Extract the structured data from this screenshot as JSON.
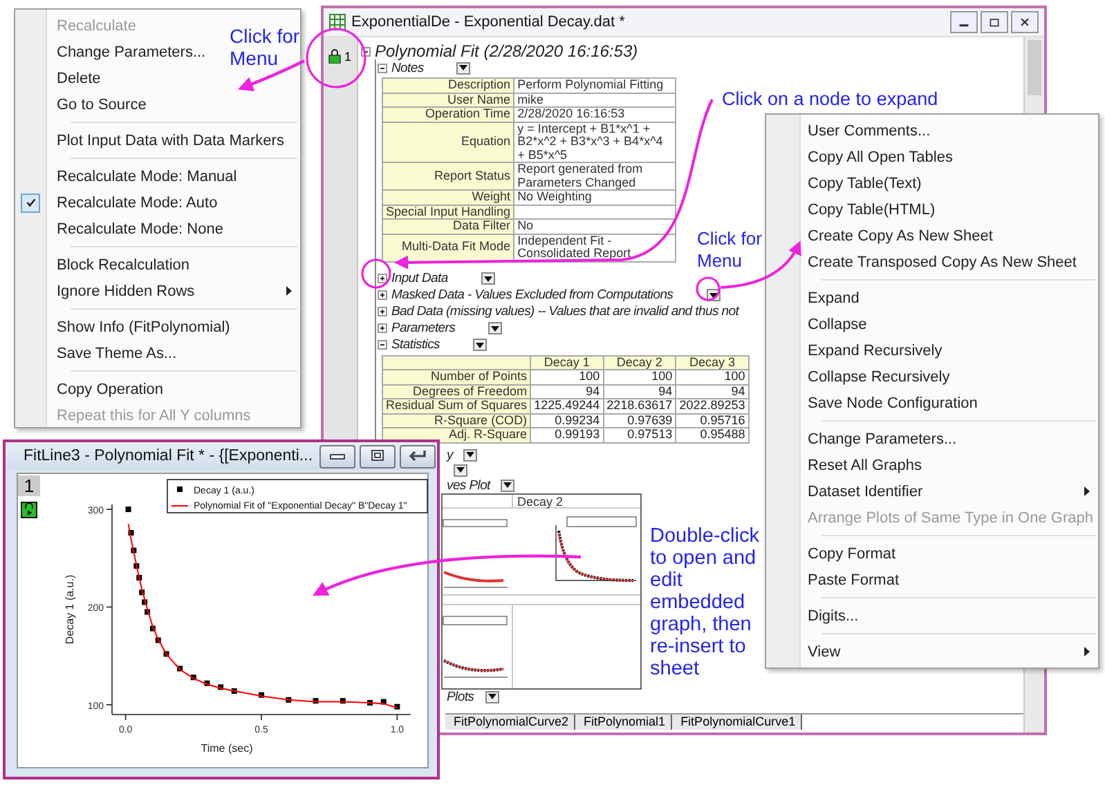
{
  "left_menu": {
    "items": [
      {
        "kind": "item",
        "label": "Recalculate",
        "disabled": true,
        "checked": false,
        "submenu": false
      },
      {
        "kind": "item",
        "label": "Change Parameters...",
        "disabled": false,
        "checked": false,
        "submenu": false
      },
      {
        "kind": "item",
        "label": "Delete",
        "disabled": false,
        "checked": false,
        "submenu": false
      },
      {
        "kind": "item",
        "label": "Go to Source",
        "disabled": false,
        "checked": false,
        "submenu": false
      },
      {
        "kind": "separator"
      },
      {
        "kind": "item",
        "label": "Plot Input Data with Data Markers",
        "disabled": false,
        "checked": false,
        "submenu": false
      },
      {
        "kind": "separator"
      },
      {
        "kind": "item",
        "label": "Recalculate Mode: Manual",
        "disabled": false,
        "checked": false,
        "submenu": false
      },
      {
        "kind": "item",
        "label": "Recalculate Mode: Auto",
        "disabled": false,
        "checked": true,
        "submenu": false
      },
      {
        "kind": "item",
        "label": "Recalculate Mode: None",
        "disabled": false,
        "checked": false,
        "submenu": false
      },
      {
        "kind": "separator"
      },
      {
        "kind": "item",
        "label": "Block Recalculation",
        "disabled": false,
        "checked": false,
        "submenu": false
      },
      {
        "kind": "item",
        "label": "Ignore Hidden Rows",
        "disabled": false,
        "checked": false,
        "submenu": true
      },
      {
        "kind": "separator"
      },
      {
        "kind": "item",
        "label": "Show Info (FitPolynomial)",
        "disabled": false,
        "checked": false,
        "submenu": false
      },
      {
        "kind": "item",
        "label": "Save Theme As...",
        "disabled": false,
        "checked": false,
        "submenu": false
      },
      {
        "kind": "separator"
      },
      {
        "kind": "item",
        "label": "Copy Operation",
        "disabled": false,
        "checked": false,
        "submenu": false
      },
      {
        "kind": "item",
        "label": "Repeat this for All Y columns",
        "disabled": true,
        "checked": false,
        "submenu": false
      }
    ]
  },
  "report_window": {
    "title": "ExponentialDe - Exponential Decay.dat *",
    "row_label": "1",
    "root": {
      "label": "Polynomial Fit (2/28/2020 16:16:53)",
      "expanded": true
    },
    "nodes": [
      {
        "kind": "table",
        "label": "Notes",
        "expanded": true,
        "dropdown": true,
        "rows": [
          {
            "label": "Description",
            "value": "Perform Polynomial Fitting"
          },
          {
            "label": "User Name",
            "value": "mike"
          },
          {
            "label": "Operation Time",
            "value": "2/28/2020 16:16:53"
          },
          {
            "label": "Equation",
            "value": "y = Intercept + B1*x^1 + B2*x^2 + B3*x^3 + B4*x^4 + B5*x^5"
          },
          {
            "label": "Report Status",
            "value": "Report generated from Parameters Changed"
          },
          {
            "label": "Weight",
            "value": "No Weighting"
          },
          {
            "label": "Special Input Handling",
            "value": ""
          },
          {
            "label": "Data Filter",
            "value": "No"
          },
          {
            "label": "Multi-Data Fit Mode",
            "value": "Independent Fit - Consolidated Report"
          }
        ]
      },
      {
        "kind": "node",
        "label": "Input Data",
        "expanded": false,
        "dropdown": true
      },
      {
        "kind": "node",
        "label": "Masked Data - Values Excluded from Computations",
        "expanded": false,
        "dropdown": true
      },
      {
        "kind": "node",
        "label": "Bad Data (missing values) -- Values that are invalid and thus not",
        "expanded": false,
        "dropdown": false
      },
      {
        "kind": "node",
        "label": "Parameters",
        "expanded": false,
        "dropdown": true
      },
      {
        "kind": "stats",
        "label": "Statistics",
        "expanded": true,
        "dropdown": true,
        "columns": [
          "Decay 1",
          "Decay 2",
          "Decay 3"
        ],
        "rows": [
          {
            "label": "Number of Points",
            "values": [
              "100",
              "100",
              "100"
            ]
          },
          {
            "label": "Degrees of Freedom",
            "values": [
              "94",
              "94",
              "94"
            ]
          },
          {
            "label": "Residual Sum of Squares",
            "values": [
              "1225.49244",
              "2218.63617",
              "2022.89253"
            ]
          },
          {
            "label": "R-Square (COD)",
            "values": [
              "0.99234",
              "0.97639",
              "0.95716"
            ]
          },
          {
            "label": "Adj. R-Square",
            "values": [
              "0.99193",
              "0.97513",
              "0.95488"
            ]
          }
        ]
      },
      {
        "kind": "clipped",
        "label": "y",
        "dropdown": true
      },
      {
        "kind": "clipped",
        "dropdown": true
      },
      {
        "kind": "clipped",
        "label": "ves Plot",
        "dropdown": true
      },
      {
        "kind": "graphs",
        "header": "Decay 2"
      },
      {
        "kind": "clipped",
        "label": "Plots",
        "dropdown": true
      }
    ],
    "sheet_tabs": [
      {
        "label": "FitPolynomialCurve2",
        "selected": false
      },
      {
        "label": "FitPolynomial1",
        "selected": false
      },
      {
        "label": "FitPolynomialCurve1",
        "selected": false
      }
    ]
  },
  "right_menu": {
    "items": [
      {
        "kind": "item",
        "label": "User Comments...",
        "disabled": false,
        "submenu": false
      },
      {
        "kind": "item",
        "label": "Copy All Open Tables",
        "disabled": false,
        "submenu": false
      },
      {
        "kind": "item",
        "label": "Copy Table(Text)",
        "disabled": false,
        "submenu": false
      },
      {
        "kind": "item",
        "label": "Copy Table(HTML)",
        "disabled": false,
        "submenu": false
      },
      {
        "kind": "item",
        "label": "Create Copy As New Sheet",
        "disabled": false,
        "submenu": false
      },
      {
        "kind": "item",
        "label": "Create Transposed Copy As New Sheet",
        "disabled": false,
        "submenu": false
      },
      {
        "kind": "separator"
      },
      {
        "kind": "item",
        "label": "Expand",
        "disabled": false,
        "submenu": false
      },
      {
        "kind": "item",
        "label": "Collapse",
        "disabled": false,
        "submenu": false
      },
      {
        "kind": "item",
        "label": "Expand Recursively",
        "disabled": false,
        "submenu": false
      },
      {
        "kind": "item",
        "label": "Collapse Recursively",
        "disabled": false,
        "submenu": false
      },
      {
        "kind": "item",
        "label": "Save Node Configuration",
        "disabled": false,
        "submenu": false
      },
      {
        "kind": "separator"
      },
      {
        "kind": "item",
        "label": "Change Parameters...",
        "disabled": false,
        "submenu": false
      },
      {
        "kind": "item",
        "label": "Reset All Graphs",
        "disabled": false,
        "submenu": false
      },
      {
        "kind": "item",
        "label": "Dataset Identifier",
        "disabled": false,
        "submenu": true
      },
      {
        "kind": "item",
        "label": "Arrange Plots of Same Type in One Graph",
        "disabled": true,
        "submenu": false
      },
      {
        "kind": "separator"
      },
      {
        "kind": "item",
        "label": "Copy Format",
        "disabled": false,
        "submenu": false
      },
      {
        "kind": "item",
        "label": "Paste Format",
        "disabled": false,
        "submenu": false
      },
      {
        "kind": "separator"
      },
      {
        "kind": "item",
        "label": "Digits...",
        "disabled": false,
        "submenu": false
      },
      {
        "kind": "separator"
      },
      {
        "kind": "item",
        "label": "View",
        "disabled": false,
        "submenu": true
      }
    ]
  },
  "graph_window": {
    "title": "FitLine3 - Polynomial Fit * - {[Exponenti...",
    "page_label": "1",
    "chart_data": {
      "type": "scatter",
      "xlabel": "Time (sec)",
      "ylabel": "Decay 1 (a.u.)",
      "x": [
        0.01,
        0.02,
        0.03,
        0.04,
        0.05,
        0.06,
        0.07,
        0.08,
        0.1,
        0.12,
        0.15,
        0.2,
        0.25,
        0.3,
        0.35,
        0.4,
        0.5,
        0.6,
        0.7,
        0.8,
        0.9,
        0.95,
        1.0
      ],
      "series": [
        {
          "name": "Decay 1 (a.u.)",
          "type": "scatter",
          "color": "#000000",
          "values": [
            300,
            276,
            258,
            242,
            230,
            215,
            205,
            195,
            178,
            166,
            152,
            137,
            128,
            122,
            118,
            114,
            110,
            105,
            104,
            104,
            102,
            103,
            98
          ]
        },
        {
          "name": "Polynomial Fit of \"Exponential Decay\" B\"Decay 1\"",
          "type": "line",
          "color": "#ff0000",
          "values": [
            285,
            270,
            256,
            243,
            230,
            218,
            208,
            198,
            180,
            167,
            152,
            136,
            127,
            121,
            117,
            114,
            109,
            105,
            103,
            103,
            102,
            101,
            97
          ]
        }
      ],
      "legend": true,
      "xlim": [
        -0.05,
        1.05
      ],
      "ylim": [
        90,
        305
      ],
      "xticks": [
        {
          "value": 0,
          "label": "0.0"
        },
        {
          "value": 0.5,
          "label": "0.5"
        },
        {
          "value": 1,
          "label": "1.0"
        }
      ],
      "yticks": [
        {
          "value": 100,
          "label": "100"
        },
        {
          "value": 200,
          "label": "200"
        },
        {
          "value": 300,
          "label": "300"
        }
      ]
    }
  },
  "annotations": [
    {
      "kind": "left_menu",
      "text": "Click for Menu"
    },
    {
      "kind": "expand",
      "text": "Click on a node to expand"
    },
    {
      "kind": "right_menu",
      "text": "Click for Menu"
    },
    {
      "kind": "graph",
      "text": "Double-click to open and edit embedded graph, then re-insert to sheet"
    }
  ]
}
